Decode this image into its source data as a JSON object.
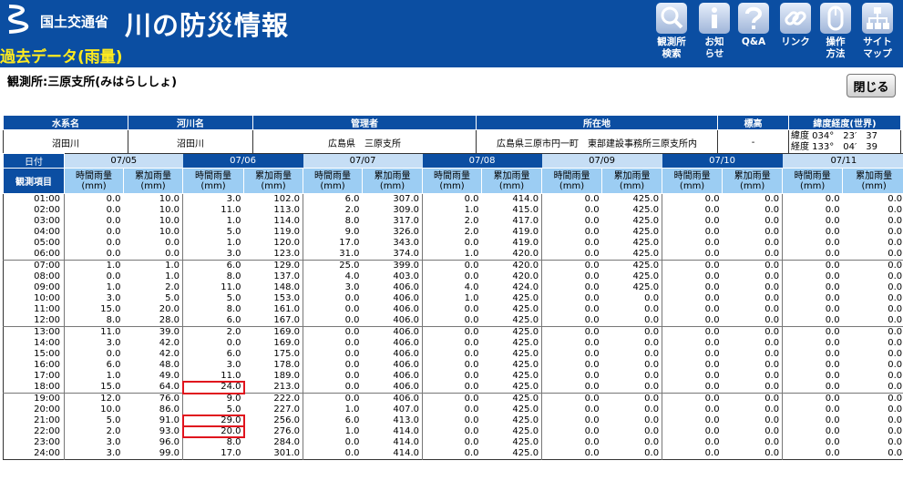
{
  "header": {
    "ministry": "国土交通省",
    "site_title": "川の防災情報",
    "page_title": "過去データ(雨量)",
    "nav": [
      {
        "label": "観測所\n検索",
        "icon": "magnifier-icon"
      },
      {
        "label": "お知\nらせ",
        "icon": "info-icon"
      },
      {
        "label": "Q&A",
        "icon": "question-icon"
      },
      {
        "label": "リンク",
        "icon": "link-icon"
      },
      {
        "label": "操作\n方法",
        "icon": "mouse-icon"
      },
      {
        "label": "サイト\nマップ",
        "icon": "sitemap-icon"
      }
    ]
  },
  "station_label": "観測所:三原支所(みはらししょ)",
  "close_button": "閉じる",
  "info": {
    "headers": [
      "水系名",
      "河川名",
      "管理者",
      "所在地",
      "標高",
      "緯度経度(世界)"
    ],
    "water_system": "沼田川",
    "river": "沼田川",
    "manager": "広島県　三原支所",
    "location": "広島県三原市円一町　東部建設事務所三原支所内",
    "elevation": "-",
    "latitude": "緯度 034°　23′　37",
    "longitude": "経度 133°　04′　39"
  },
  "table": {
    "date_label": "日付",
    "item_label": "観測項目",
    "hourly_label": "時間雨量",
    "cumulative_label": "累加雨量",
    "unit_label": "(mm)",
    "dates": [
      "07/05",
      "07/06",
      "07/07",
      "07/08",
      "07/09",
      "07/10",
      "07/11"
    ],
    "rows": [
      [
        "01:00",
        "0.0",
        "10.0",
        "3.0",
        "102.0",
        "6.0",
        "307.0",
        "0.0",
        "414.0",
        "0.0",
        "425.0",
        "0.0",
        "0.0",
        "0.0",
        "0.0"
      ],
      [
        "02:00",
        "0.0",
        "10.0",
        "11.0",
        "113.0",
        "2.0",
        "309.0",
        "1.0",
        "415.0",
        "0.0",
        "425.0",
        "0.0",
        "0.0",
        "0.0",
        "0.0"
      ],
      [
        "03:00",
        "0.0",
        "10.0",
        "1.0",
        "114.0",
        "8.0",
        "317.0",
        "2.0",
        "417.0",
        "0.0",
        "425.0",
        "0.0",
        "0.0",
        "0.0",
        "0.0"
      ],
      [
        "04:00",
        "0.0",
        "10.0",
        "5.0",
        "119.0",
        "9.0",
        "326.0",
        "2.0",
        "419.0",
        "0.0",
        "425.0",
        "0.0",
        "0.0",
        "0.0",
        "0.0"
      ],
      [
        "05:00",
        "0.0",
        "0.0",
        "1.0",
        "120.0",
        "17.0",
        "343.0",
        "0.0",
        "419.0",
        "0.0",
        "425.0",
        "0.0",
        "0.0",
        "0.0",
        "0.0"
      ],
      [
        "06:00",
        "0.0",
        "0.0",
        "3.0",
        "123.0",
        "31.0",
        "374.0",
        "1.0",
        "420.0",
        "0.0",
        "425.0",
        "0.0",
        "0.0",
        "0.0",
        "0.0"
      ],
      [
        "07:00",
        "1.0",
        "1.0",
        "6.0",
        "129.0",
        "25.0",
        "399.0",
        "0.0",
        "420.0",
        "0.0",
        "425.0",
        "0.0",
        "0.0",
        "0.0",
        "0.0"
      ],
      [
        "08:00",
        "0.0",
        "1.0",
        "8.0",
        "137.0",
        "4.0",
        "403.0",
        "0.0",
        "420.0",
        "0.0",
        "425.0",
        "0.0",
        "0.0",
        "0.0",
        "0.0"
      ],
      [
        "09:00",
        "1.0",
        "2.0",
        "11.0",
        "148.0",
        "3.0",
        "406.0",
        "4.0",
        "424.0",
        "0.0",
        "425.0",
        "0.0",
        "0.0",
        "0.0",
        "0.0"
      ],
      [
        "10:00",
        "3.0",
        "5.0",
        "5.0",
        "153.0",
        "0.0",
        "406.0",
        "1.0",
        "425.0",
        "0.0",
        "0.0",
        "0.0",
        "0.0",
        "0.0",
        "0.0"
      ],
      [
        "11:00",
        "15.0",
        "20.0",
        "8.0",
        "161.0",
        "0.0",
        "406.0",
        "0.0",
        "425.0",
        "0.0",
        "0.0",
        "0.0",
        "0.0",
        "0.0",
        "0.0"
      ],
      [
        "12:00",
        "8.0",
        "28.0",
        "6.0",
        "167.0",
        "0.0",
        "406.0",
        "0.0",
        "425.0",
        "0.0",
        "0.0",
        "0.0",
        "0.0",
        "0.0",
        "0.0"
      ],
      [
        "13:00",
        "11.0",
        "39.0",
        "2.0",
        "169.0",
        "0.0",
        "406.0",
        "0.0",
        "425.0",
        "0.0",
        "0.0",
        "0.0",
        "0.0",
        "0.0",
        "0.0"
      ],
      [
        "14:00",
        "3.0",
        "42.0",
        "0.0",
        "169.0",
        "0.0",
        "406.0",
        "0.0",
        "425.0",
        "0.0",
        "0.0",
        "0.0",
        "0.0",
        "0.0",
        "0.0"
      ],
      [
        "15:00",
        "0.0",
        "42.0",
        "6.0",
        "175.0",
        "0.0",
        "406.0",
        "0.0",
        "425.0",
        "0.0",
        "0.0",
        "0.0",
        "0.0",
        "0.0",
        "0.0"
      ],
      [
        "16:00",
        "6.0",
        "48.0",
        "3.0",
        "178.0",
        "0.0",
        "406.0",
        "0.0",
        "425.0",
        "0.0",
        "0.0",
        "0.0",
        "0.0",
        "0.0",
        "0.0"
      ],
      [
        "17:00",
        "1.0",
        "49.0",
        "11.0",
        "189.0",
        "0.0",
        "406.0",
        "0.0",
        "425.0",
        "0.0",
        "0.0",
        "0.0",
        "0.0",
        "0.0",
        "0.0"
      ],
      [
        "18:00",
        "15.0",
        "64.0",
        "24.0",
        "213.0",
        "0.0",
        "406.0",
        "0.0",
        "425.0",
        "0.0",
        "0.0",
        "0.0",
        "0.0",
        "0.0",
        "0.0"
      ],
      [
        "19:00",
        "12.0",
        "76.0",
        "9.0",
        "222.0",
        "0.0",
        "406.0",
        "0.0",
        "425.0",
        "0.0",
        "0.0",
        "0.0",
        "0.0",
        "0.0",
        "0.0"
      ],
      [
        "20:00",
        "10.0",
        "86.0",
        "5.0",
        "227.0",
        "1.0",
        "407.0",
        "0.0",
        "425.0",
        "0.0",
        "0.0",
        "0.0",
        "0.0",
        "0.0",
        "0.0"
      ],
      [
        "21:00",
        "5.0",
        "91.0",
        "29.0",
        "256.0",
        "6.0",
        "413.0",
        "0.0",
        "425.0",
        "0.0",
        "0.0",
        "0.0",
        "0.0",
        "0.0",
        "0.0"
      ],
      [
        "22:00",
        "2.0",
        "93.0",
        "20.0",
        "276.0",
        "1.0",
        "414.0",
        "0.0",
        "425.0",
        "0.0",
        "0.0",
        "0.0",
        "0.0",
        "0.0",
        "0.0"
      ],
      [
        "23:00",
        "3.0",
        "96.0",
        "8.0",
        "284.0",
        "0.0",
        "414.0",
        "0.0",
        "425.0",
        "0.0",
        "0.0",
        "0.0",
        "0.0",
        "0.0",
        "0.0"
      ],
      [
        "24:00",
        "3.0",
        "99.0",
        "17.0",
        "301.0",
        "0.0",
        "414.0",
        "0.0",
        "425.0",
        "0.0",
        "0.0",
        "0.0",
        "0.0",
        "0.0",
        "0.0"
      ]
    ],
    "highlighted_cells": [
      "07/06 18:00",
      "07/06 21:00",
      "07/06 22:00"
    ]
  },
  "colors": {
    "header_bg": "#0b4ea2",
    "page_title": "#ffeb1f",
    "subheader_bg": "#9ccdf3",
    "date_alt_bg": "#c6def5",
    "highlight": "#e0141e"
  }
}
